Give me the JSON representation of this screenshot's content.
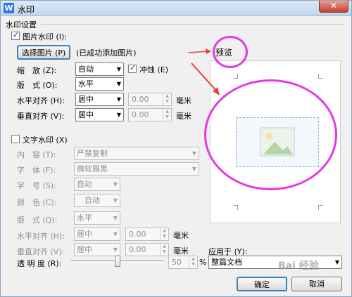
{
  "titlebar": {
    "app_icon": "W",
    "title": "水印",
    "close": "✕"
  },
  "section_label": "水印设置",
  "image_watermark": {
    "checkbox_label": "图片水印 (I):",
    "select_button": "选择图片 (P)",
    "status": "(已成功添加图片)",
    "scale_label": "缩　放 (Z):",
    "scale_value": "自动",
    "washout_label": "冲蚀 (E)",
    "layout_label": "版　式 (O):",
    "layout_value": "水平",
    "h_align_label": "水平对齐 (H):",
    "h_align_value": "居中",
    "h_offset": "0.00",
    "v_align_label": "垂直对齐 (V):",
    "v_align_value": "居中",
    "v_offset": "0.00",
    "unit": "毫米"
  },
  "text_watermark": {
    "checkbox_label": "文字水印 (X)",
    "content_label": "内　容 (T):",
    "content_value": "严禁复制",
    "font_label": "字　体 (F):",
    "font_value": "微软雅黑",
    "size_label": "字　号 (S):",
    "size_value": "自动",
    "color_label": "颜　色 (C):",
    "color_value": "自动",
    "layout_label": "版　式 (Q):",
    "layout_value": "水平",
    "h_align_label": "水平对齐 (H):",
    "h_align_value": "居中",
    "h_offset": "0.00",
    "v_align_label": "垂直对齐 (V):",
    "v_align_value": "居中",
    "v_offset": "0.00",
    "unit": "毫米",
    "transparency_label": "透 明 度 (R):",
    "transparency_value": "50",
    "transparency_unit": "%"
  },
  "preview": {
    "label": "预览"
  },
  "apply": {
    "label": "应用于 (Y):",
    "value": "整篇文档"
  },
  "buttons": {
    "ok": "确定",
    "cancel": "取消"
  },
  "watermark_text": "Bai 经验",
  "colors": {
    "annotation": "#e33be3",
    "arrow": "#e8403a"
  }
}
